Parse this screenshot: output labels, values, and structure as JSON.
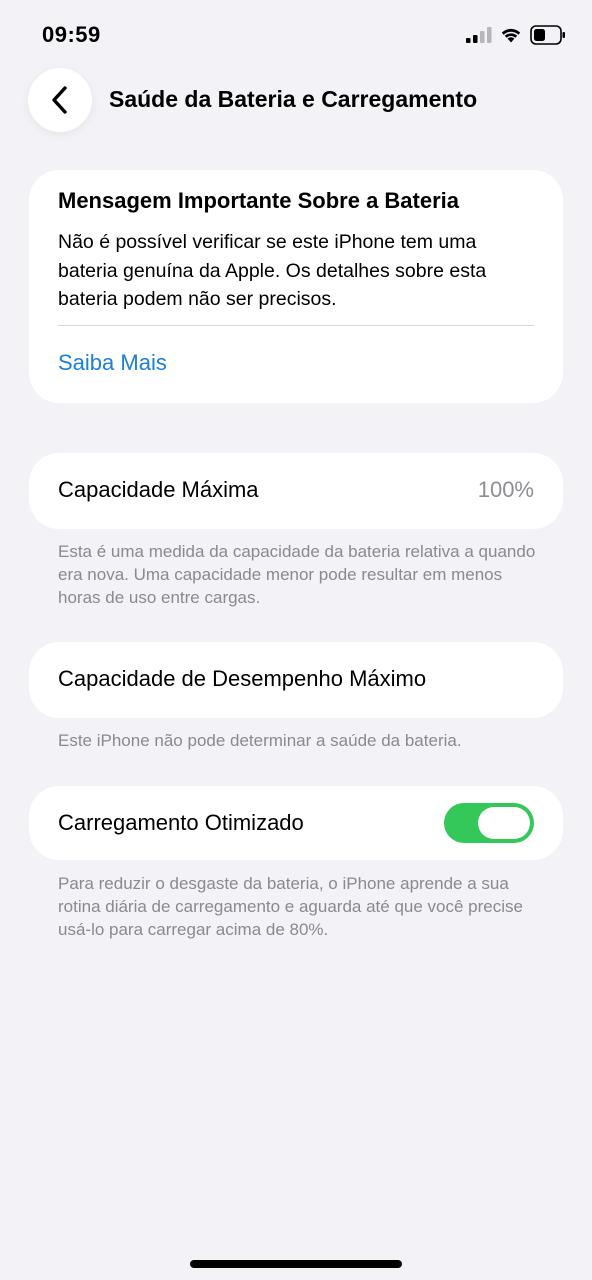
{
  "status_bar": {
    "time": "09:59",
    "icons": [
      "cellular-signal-icon",
      "wifi-icon",
      "battery-icon"
    ]
  },
  "nav": {
    "back_icon": "chevron-left-icon",
    "title": "Saúde da Bateria e Carregamento"
  },
  "important_message": {
    "title": "Mensagem Importante Sobre a Bateria",
    "body": "Não é possível verificar se este iPhone tem uma bateria genuína da Apple. Os detalhes sobre esta bateria podem não ser precisos.",
    "link": "Saiba Mais"
  },
  "max_capacity": {
    "label": "Capacidade Máxima",
    "value": "100%",
    "footnote": "Esta é uma medida da capacidade da bateria relativa a quando era nova. Uma capacidade menor pode resultar em menos horas de uso entre cargas."
  },
  "peak_performance": {
    "label": "Capacidade de Desempenho Máximo",
    "footnote": "Este iPhone não pode determinar a saúde da bateria."
  },
  "optimized_charging": {
    "label": "Carregamento Otimizado",
    "enabled": true,
    "footnote": "Para reduzir o desgaste da bateria, o iPhone aprende a sua rotina diária de carregamento e aguarda até que você precise usá-lo para carregar acima de 80%."
  },
  "colors": {
    "background": "#f2f2f7",
    "card": "#ffffff",
    "link": "#1a80d9",
    "toggle_on": "#34c759",
    "secondary_text": "#8e8e93"
  }
}
